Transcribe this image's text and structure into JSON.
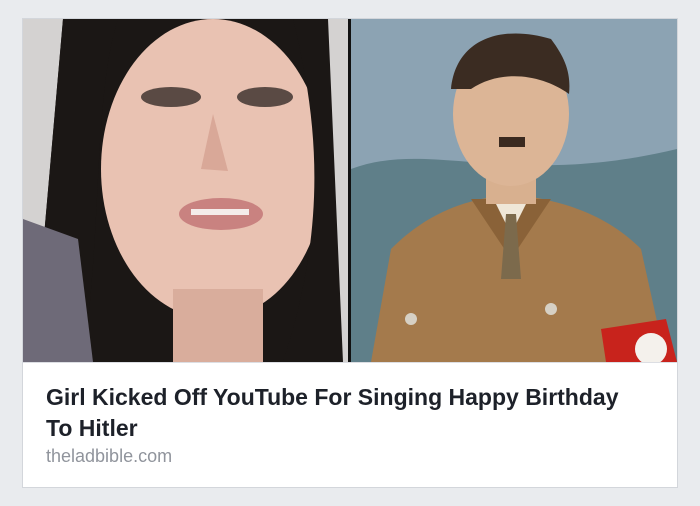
{
  "link_preview": {
    "headline": "Girl Kicked Off YouTube For Singing Happy Birthday To Hitler",
    "domain": "theladbible.com"
  },
  "images": {
    "left": "young-woman-photo",
    "right": "uniformed-man-portrait"
  },
  "colors": {
    "background": "#e9ebee",
    "card": "#ffffff",
    "headline": "#1d2129",
    "domain": "#90949c"
  }
}
